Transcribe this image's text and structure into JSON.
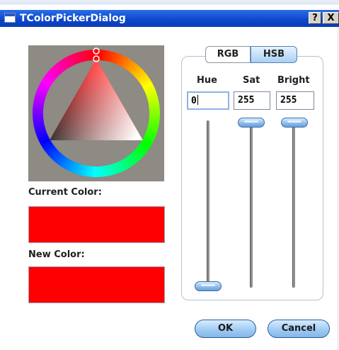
{
  "window": {
    "title": "TColorPickerDialog",
    "help_glyph": "?",
    "close_glyph": "X"
  },
  "picker": {
    "current_label": "Current Color:",
    "new_label": "New Color:",
    "current_color": "#ff0000",
    "new_color": "#ff0000"
  },
  "tabs": {
    "rgb": "RGB",
    "hsb": "HSB",
    "active": "HSB"
  },
  "hsb": {
    "hue_label": "Hue",
    "sat_label": "Sat",
    "bright_label": "Bright",
    "hue_value": "0",
    "sat_value": "255",
    "bright_value": "255"
  },
  "buttons": {
    "ok": "OK",
    "cancel": "Cancel"
  },
  "icons": {
    "window_icon": "window-icon",
    "help": "help-icon",
    "close": "close-icon"
  }
}
